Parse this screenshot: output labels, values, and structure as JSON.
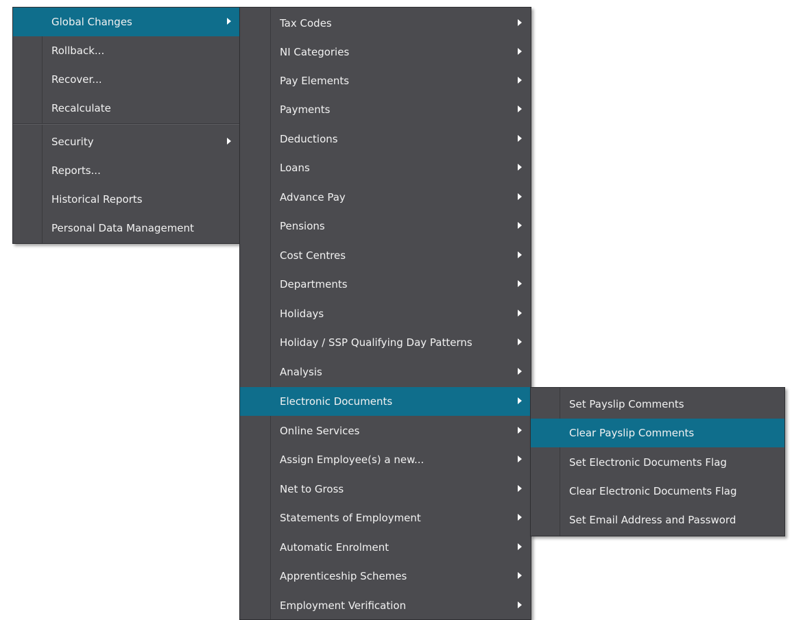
{
  "colors": {
    "menu_bg": "#4b4b4f",
    "highlight": "#0f6e8c",
    "text": "#f2f2f2"
  },
  "menu1": {
    "items": [
      {
        "label": "Global Changes",
        "submenu": true,
        "highlighted": true
      },
      {
        "label": "Rollback...",
        "submenu": false
      },
      {
        "label": "Recover...",
        "submenu": false
      },
      {
        "label": "Recalculate",
        "submenu": false
      },
      {
        "label": "Security",
        "submenu": true
      },
      {
        "label": "Reports...",
        "submenu": false
      },
      {
        "label": "Historical Reports",
        "submenu": false
      },
      {
        "label": "Personal Data Management",
        "submenu": false
      }
    ]
  },
  "menu2": {
    "items": [
      {
        "label": "Tax Codes",
        "submenu": true
      },
      {
        "label": "NI Categories",
        "submenu": true
      },
      {
        "label": "Pay Elements",
        "submenu": true
      },
      {
        "label": "Payments",
        "submenu": true
      },
      {
        "label": "Deductions",
        "submenu": true
      },
      {
        "label": "Loans",
        "submenu": true
      },
      {
        "label": "Advance Pay",
        "submenu": true
      },
      {
        "label": "Pensions",
        "submenu": true
      },
      {
        "label": "Cost Centres",
        "submenu": true
      },
      {
        "label": "Departments",
        "submenu": true
      },
      {
        "label": "Holidays",
        "submenu": true
      },
      {
        "label": "Holiday / SSP Qualifying Day Patterns",
        "submenu": true
      },
      {
        "label": "Analysis",
        "submenu": true
      },
      {
        "label": "Electronic Documents",
        "submenu": true,
        "highlighted": true
      },
      {
        "label": "Online Services",
        "submenu": true
      },
      {
        "label": "Assign Employee(s) a new...",
        "submenu": true
      },
      {
        "label": "Net to Gross",
        "submenu": true
      },
      {
        "label": "Statements of Employment",
        "submenu": true
      },
      {
        "label": "Automatic Enrolment",
        "submenu": true
      },
      {
        "label": "Apprenticeship Schemes",
        "submenu": true
      },
      {
        "label": "Employment Verification",
        "submenu": true
      }
    ]
  },
  "menu3": {
    "items": [
      {
        "label": "Set Payslip Comments",
        "submenu": false
      },
      {
        "label": "Clear Payslip Comments",
        "submenu": false,
        "highlighted": true
      },
      {
        "label": "Set Electronic Documents Flag",
        "submenu": false
      },
      {
        "label": "Clear Electronic Documents Flag",
        "submenu": false
      },
      {
        "label": "Set Email Address and Password",
        "submenu": false
      }
    ]
  }
}
